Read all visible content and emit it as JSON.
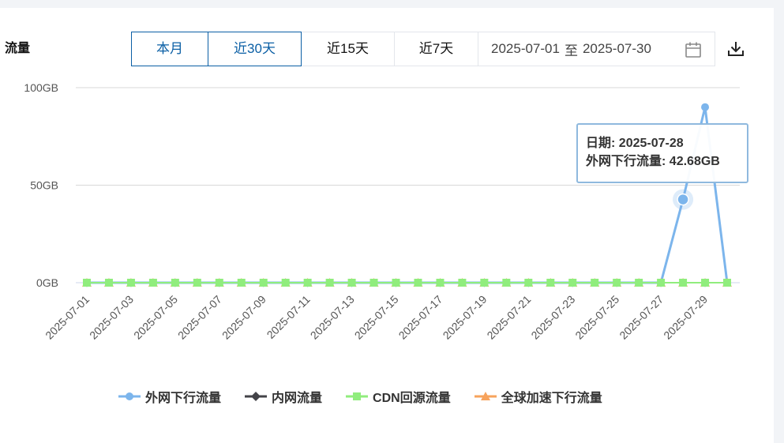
{
  "header": {
    "title": "流量",
    "ranges": [
      {
        "label": "本月",
        "active": true
      },
      {
        "label": "近30天",
        "active": true
      },
      {
        "label": "近15天",
        "active": false
      },
      {
        "label": "近7天",
        "active": false
      }
    ],
    "date_start": "2025-07-01",
    "date_sep": "至",
    "date_end": "2025-07-30",
    "icons": {
      "calendar": "calendar-icon",
      "download": "download-icon"
    }
  },
  "tooltip": {
    "date_label": "日期",
    "date_value": "2025-07-28",
    "series_label": "外网下行流量",
    "series_value": "42.68GB"
  },
  "chart_data": {
    "type": "line",
    "x": [
      "2025-07-01",
      "2025-07-02",
      "2025-07-03",
      "2025-07-04",
      "2025-07-05",
      "2025-07-06",
      "2025-07-07",
      "2025-07-08",
      "2025-07-09",
      "2025-07-10",
      "2025-07-11",
      "2025-07-12",
      "2025-07-13",
      "2025-07-14",
      "2025-07-15",
      "2025-07-16",
      "2025-07-17",
      "2025-07-18",
      "2025-07-19",
      "2025-07-20",
      "2025-07-21",
      "2025-07-22",
      "2025-07-23",
      "2025-07-24",
      "2025-07-25",
      "2025-07-26",
      "2025-07-27",
      "2025-07-28",
      "2025-07-29",
      "2025-07-30"
    ],
    "x_tick_labels": [
      "2025-07-01",
      "2025-07-03",
      "2025-07-05",
      "2025-07-07",
      "2025-07-09",
      "2025-07-11",
      "2025-07-13",
      "2025-07-15",
      "2025-07-17",
      "2025-07-19",
      "2025-07-21",
      "2025-07-23",
      "2025-07-25",
      "2025-07-27",
      "2025-07-29"
    ],
    "y_ticks": [
      {
        "value": 0,
        "label": "0GB"
      },
      {
        "value": 50,
        "label": "50GB"
      },
      {
        "value": 100,
        "label": "100GB"
      }
    ],
    "ylim": [
      0,
      100
    ],
    "unit": "GB",
    "grid": true,
    "legend_position": "bottom",
    "series": [
      {
        "name": "外网下行流量",
        "color": "#7cb5ec",
        "marker": "circle",
        "values": [
          0,
          0,
          0,
          0,
          0,
          0,
          0,
          0,
          0,
          0,
          0,
          0,
          0,
          0,
          0,
          0,
          0,
          0,
          0,
          0,
          0,
          0,
          0,
          0,
          0,
          0,
          0,
          42.68,
          90,
          0
        ]
      },
      {
        "name": "内网流量",
        "color": "#434348",
        "marker": "diamond",
        "values": [
          0,
          0,
          0,
          0,
          0,
          0,
          0,
          0,
          0,
          0,
          0,
          0,
          0,
          0,
          0,
          0,
          0,
          0,
          0,
          0,
          0,
          0,
          0,
          0,
          0,
          0,
          0,
          0,
          0,
          0
        ]
      },
      {
        "name": "CDN回源流量",
        "color": "#90ed7d",
        "marker": "square",
        "values": [
          0,
          0,
          0,
          0,
          0,
          0,
          0,
          0,
          0,
          0,
          0,
          0,
          0,
          0,
          0,
          0,
          0,
          0,
          0,
          0,
          0,
          0,
          0,
          0,
          0,
          0,
          0,
          0,
          0,
          0
        ]
      },
      {
        "name": "全球加速下行流量",
        "color": "#f7a35c",
        "marker": "triangle",
        "values": [
          0,
          0,
          0,
          0,
          0,
          0,
          0,
          0,
          0,
          0,
          0,
          0,
          0,
          0,
          0,
          0,
          0,
          0,
          0,
          0,
          0,
          0,
          0,
          0,
          0,
          0,
          0,
          0,
          0,
          0
        ]
      }
    ],
    "highlight_index": 27
  }
}
